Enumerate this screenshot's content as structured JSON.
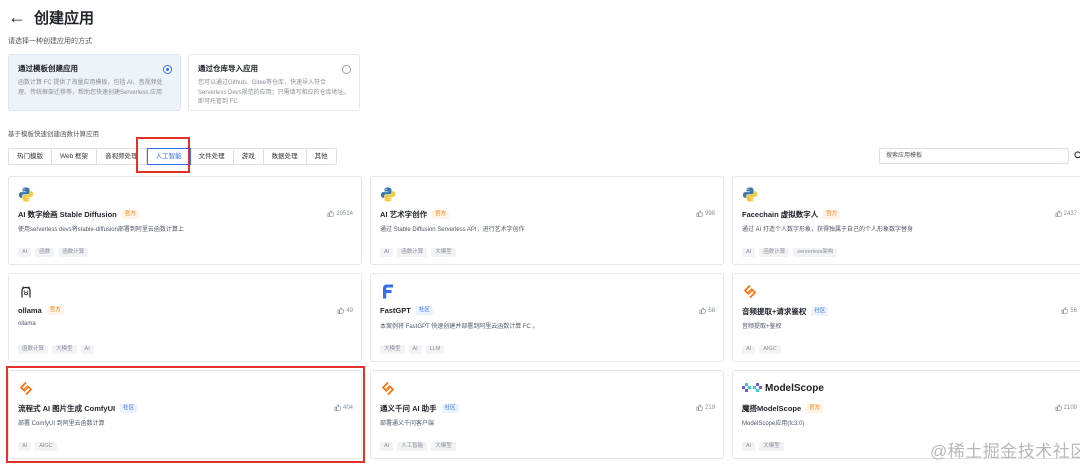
{
  "header": {
    "title": "创建应用",
    "back_icon": "arrow-left-icon"
  },
  "create_method": {
    "label": "请选择一种创建应用的方式",
    "options": [
      {
        "title": "通过模板创建应用",
        "desc": "函数计算 FC 提供了海量应用模板，包括 AI、音视频处理、传统框架迁移等，帮助您快速创建Serverless 应用",
        "selected": true
      },
      {
        "title": "通过仓库导入应用",
        "desc": "您可以通过Github、Gitee等仓库，快速导入符合Serverless Devs规范的应用；只需填写相应的仓库地址，即可托管到 FC",
        "selected": false
      }
    ]
  },
  "templates": {
    "label": "基于模板快速创建函数计算应用",
    "tabs": [
      "热门模版",
      "Web 框架",
      "音视频处理",
      "人工智能",
      "文件处理",
      "游戏",
      "数据处理",
      "其他"
    ],
    "active_tab": "人工智能",
    "search_placeholder": "搜索应用模板",
    "cards": [
      {
        "title": "AI 数字绘画 Stable Diffusion",
        "badge": "官方",
        "badge_type": "official",
        "likes": "20514",
        "desc": "使用serverless devs将stable-diffusion部署到阿里云函数计算上",
        "tags": [
          "AI",
          "函数",
          "函数计算"
        ],
        "logo": "python-logo-icon"
      },
      {
        "title": "AI 艺术字创作",
        "badge": "官方",
        "badge_type": "official",
        "likes": "998",
        "desc": "通过 Stable Diffusion Serverless API，进行艺术字创作",
        "tags": [
          "AI",
          "函数计算",
          "大模型"
        ],
        "logo": "python-logo-icon"
      },
      {
        "title": "Facechain 虚拟数字人",
        "badge": "官方",
        "badge_type": "official",
        "likes": "2437",
        "desc": "通过 AI 打造个人数字形象，获得独属于自己的个人形象数字替身",
        "tags": [
          "AI",
          "函数计算",
          "serverless架构"
        ],
        "logo": "python-logo-icon"
      },
      {
        "title": "ollama",
        "badge": "官方",
        "badge_type": "official",
        "likes": "49",
        "desc": "ollama",
        "tags": [
          "函数计算",
          "大模型",
          "AI"
        ],
        "logo": "ollama-logo-icon"
      },
      {
        "title": "FastGPT",
        "badge": "社区",
        "badge_type": "community",
        "likes": "58",
        "desc": "本案例将 FastGPT 快速创建并部署到阿里云函数计算 FC 。",
        "tags": [
          "大模型",
          "AI",
          "LLM"
        ],
        "logo": "fastgpt-logo-icon"
      },
      {
        "title": "音频提取+请求鉴权",
        "badge": "社区",
        "badge_type": "community",
        "likes": "56",
        "desc": "音频提取+鉴权",
        "tags": [
          "AI",
          "AIGC"
        ],
        "logo": "fc-logo-icon"
      },
      {
        "title": "流程式 AI 图片生成 ComfyUI",
        "badge": "社区",
        "badge_type": "community",
        "likes": "404",
        "desc": "部署 ComfyUI 到阿里云函数计算",
        "tags": [
          "AI",
          "AIGC"
        ],
        "logo": "fc-logo-icon"
      },
      {
        "title": "通义千问 AI 助手",
        "badge": "社区",
        "badge_type": "community",
        "likes": "219",
        "desc": "部署通义千问客户端",
        "tags": [
          "AI",
          "人工智能",
          "大模型"
        ],
        "logo": "fc-logo-icon"
      },
      {
        "title": "魔搭ModelScope",
        "badge": "官方",
        "badge_type": "official",
        "likes": "2109",
        "desc": "ModelScope应用(fc3.0)",
        "tags": [
          "AI",
          "大模型"
        ],
        "logo": "modelscope-logo-icon",
        "logo_text": "ModelScope"
      }
    ]
  },
  "watermark": "@稀土掘金技术社区",
  "colors": {
    "accent": "#2f6ff0",
    "official": "#ff7d00",
    "highlight": "#e0312a"
  }
}
